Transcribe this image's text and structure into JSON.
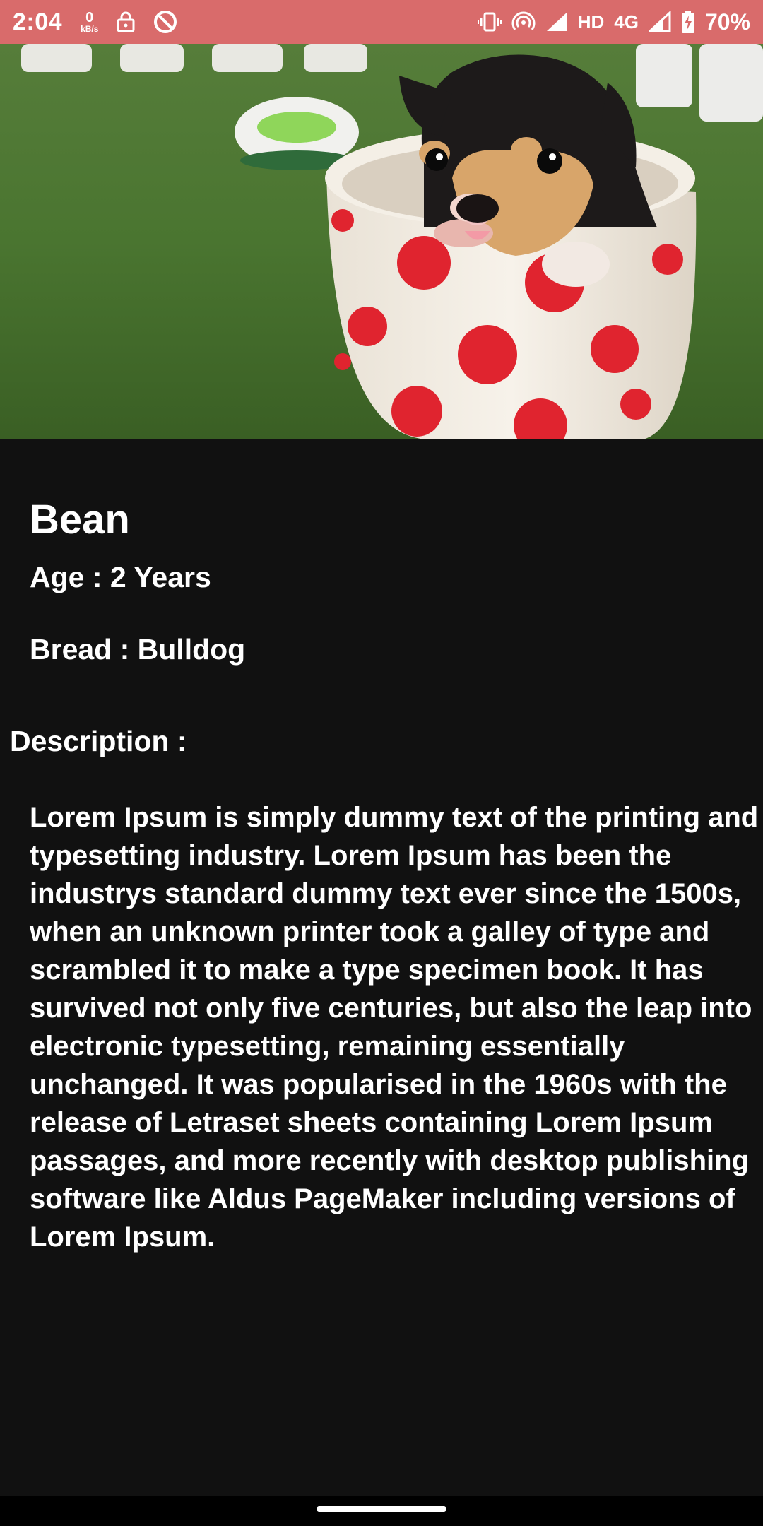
{
  "status_bar": {
    "time": "2:04",
    "net_speed_value": "0",
    "net_speed_unit": "kB/s",
    "network_label": "HD",
    "network_type": "4G",
    "battery": "70%",
    "icons": [
      "lock-icon",
      "do-not-disturb-icon",
      "vibrate-icon",
      "hotspot-icon",
      "signal-icon",
      "signal-icon",
      "battery-charging-icon"
    ]
  },
  "pet": {
    "name": "Bean",
    "age_line": "Age : 2 Years",
    "breed_line": "Bread : Bulldog",
    "image": "puppy-in-polka-dot-cup-photo"
  },
  "description": {
    "heading": "Description :",
    "body": "Lorem Ipsum is simply dummy text of the printing and typesetting industry. Lorem Ipsum has been the industrys standard dummy text ever since the 1500s, when an unknown printer took a galley of type and scrambled it to make a type specimen book. It has survived not only five centuries, but also the leap into electronic typesetting, remaining essentially unchanged. It was popularised in the 1960s with the release of Letraset sheets containing Lorem Ipsum passages, and more recently with desktop publishing software like Aldus PageMaker including versions of Lorem Ipsum."
  },
  "colors": {
    "status_bar": "#d96b6b",
    "background": "#111111",
    "text": "#ffffff"
  }
}
